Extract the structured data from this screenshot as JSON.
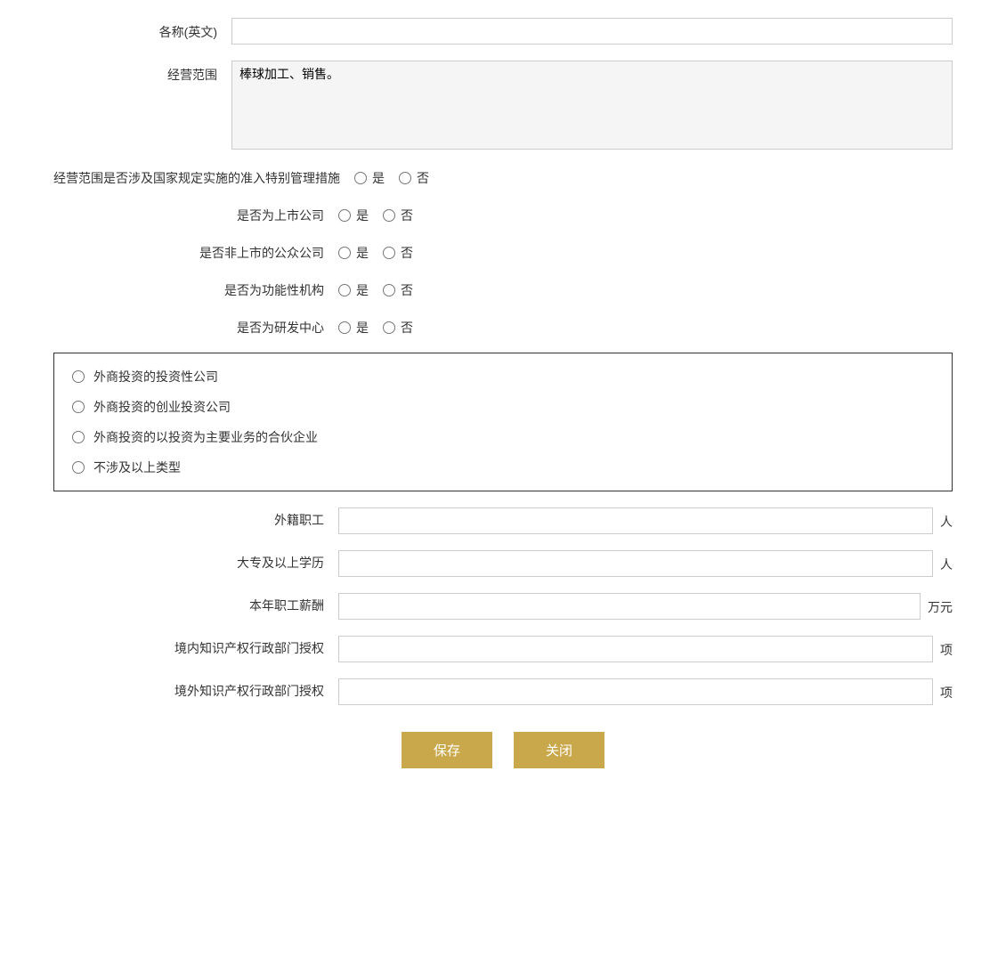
{
  "form": {
    "fields": {
      "name_english_label": "各称(英文)",
      "name_english_value": "",
      "business_scope_label": "经营范围",
      "business_scope_value": "棒球加工、销售。",
      "special_management_label": "经营范围是否涉及国家规定实施的准入特别管理措施",
      "yes_label": "是",
      "no_label": "否",
      "listed_company_label": "是否为上市公司",
      "non_listed_public_label": "是否非上市的公众公司",
      "functional_org_label": "是否为功能性机构",
      "rd_center_label": "是否为研发中心",
      "checkbox_option1": "外商投资的投资性公司",
      "checkbox_option2": "外商投资的创业投资公司",
      "checkbox_option3": "外商投资的以投资为主要业务的合伙企业",
      "checkbox_option4": "不涉及以上类型",
      "foreign_staff_label": "外籍职工",
      "foreign_staff_value": "",
      "foreign_staff_unit": "人",
      "college_edu_label": "大专及以上学历",
      "college_edu_value": "",
      "college_edu_unit": "人",
      "salary_label": "本年职工薪酬",
      "salary_value": "",
      "salary_unit": "万元",
      "domestic_ip_label": "境内知识产权行政部门授权",
      "domestic_ip_value": "",
      "domestic_ip_unit": "项",
      "foreign_ip_label": "境外知识产权行政部门授权",
      "foreign_ip_value": "",
      "foreign_ip_unit": "项"
    },
    "buttons": {
      "save_label": "保存",
      "close_label": "关闭"
    }
  }
}
